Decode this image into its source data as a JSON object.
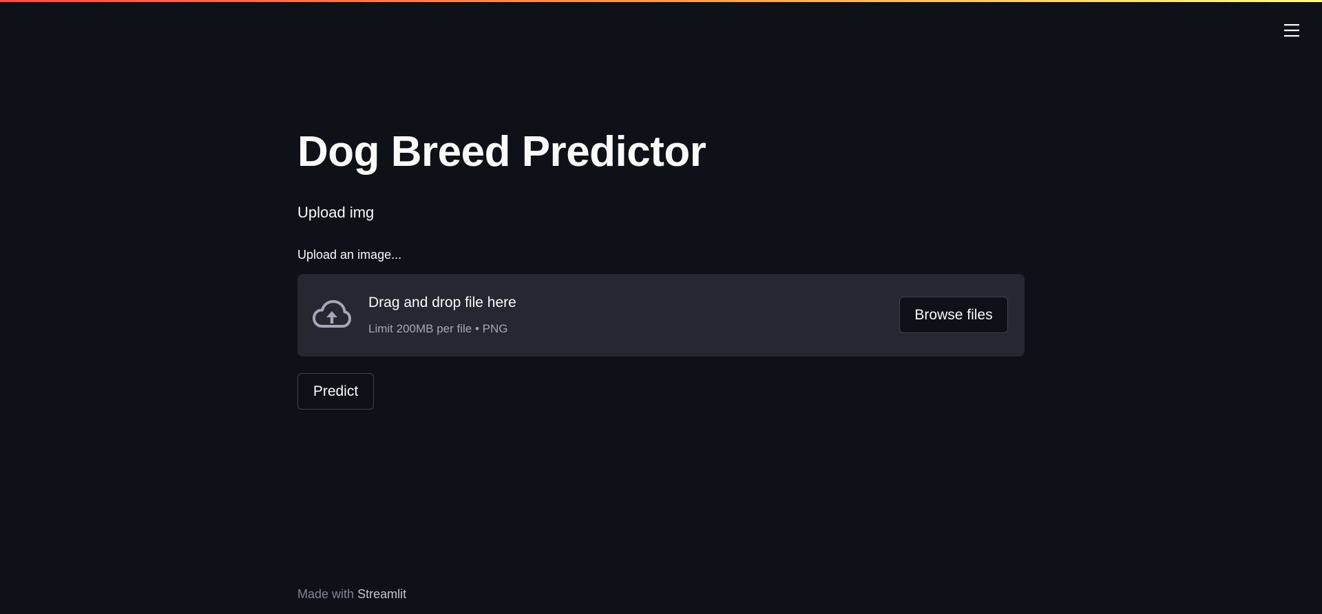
{
  "app": {
    "menu_icon": "hamburger-menu-icon",
    "accent_gradient": [
      "#ff4b4b",
      "#fffd80"
    ],
    "background_color": "#0e1117"
  },
  "main": {
    "title": "Dog Breed Predictor",
    "subheader": "Upload img",
    "uploader": {
      "label": "Upload an image...",
      "icon": "cloud-upload-icon",
      "drop_text": "Drag and drop file here",
      "limit_text": "Limit 200MB per file • PNG",
      "browse_label": "Browse files",
      "background_color": "#262730"
    },
    "predict_label": "Predict"
  },
  "footer": {
    "prefix": "Made with",
    "link": "Streamlit"
  }
}
